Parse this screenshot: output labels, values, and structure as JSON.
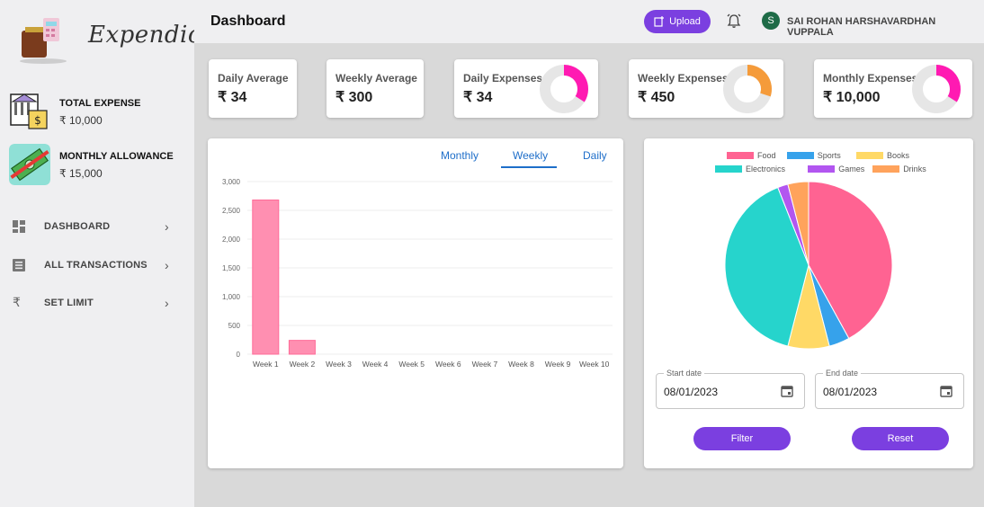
{
  "app": {
    "logo_text": "Expendio"
  },
  "sidebar": {
    "stats": [
      {
        "title": "TOTAL EXPENSE",
        "value": "₹ 10,000",
        "icon": "bank-cash-icon"
      },
      {
        "title": "MONTHLY ALLOWANCE",
        "value": "₹ 15,000",
        "icon": "money-icon"
      }
    ],
    "nav": [
      {
        "label": "DASHBOARD",
        "icon": "dashboard-icon"
      },
      {
        "label": "ALL TRANSACTIONS",
        "icon": "list-icon"
      },
      {
        "label": "SET LIMIT",
        "icon": "rupee-icon"
      }
    ]
  },
  "header": {
    "title": "Dashboard",
    "upload_label": "Upload",
    "avatar_initial": "S",
    "user_name": "SAI ROHAN HARSHAVARDHAN VUPPALA"
  },
  "summary_cards": [
    {
      "title": "Daily Average",
      "value": "₹ 34"
    },
    {
      "title": "Weekly Average",
      "value": "₹ 300"
    },
    {
      "title": "Daily Expenses",
      "value": "₹ 34",
      "fraction": 0.34,
      "color": "#ff1ab2"
    },
    {
      "title": "Weekly Expenses",
      "value": "₹ 450",
      "fraction": 0.3,
      "color": "#f59b3a"
    },
    {
      "title": "Monthly Expenses",
      "value": "₹ 10,000",
      "fraction": 0.34,
      "color": "#ff1ab2"
    }
  ],
  "bar_panel": {
    "tabs": [
      "Monthly",
      "Weekly",
      "Daily"
    ],
    "active_tab": "Weekly"
  },
  "filters": {
    "start_label": "Start date",
    "start_value": "08/01/2023",
    "end_label": "End date",
    "end_value": "08/01/2023",
    "filter_label": "Filter",
    "reset_label": "Reset"
  },
  "colors": {
    "accent": "#7b3fe0",
    "tab_blue": "#1e6ec9",
    "bar": "#ff8fb1"
  },
  "chart_data": [
    {
      "type": "bar",
      "categories": [
        "Week 1",
        "Week 2",
        "Week 3",
        "Week 4",
        "Week 5",
        "Week 6",
        "Week 7",
        "Week 8",
        "Week 9",
        "Week 10"
      ],
      "values": [
        2680,
        240,
        0,
        0,
        0,
        0,
        0,
        0,
        0,
        0
      ],
      "ylim": [
        0,
        3000
      ],
      "yticks": [
        "0",
        "500",
        "1,000",
        "1,500",
        "2,000",
        "2,500",
        "3,000"
      ],
      "grid": true,
      "color": "#ff8fb1"
    },
    {
      "type": "pie",
      "legend_position": "top",
      "series": [
        {
          "name": "Food",
          "value": 42,
          "color": "#ff6392"
        },
        {
          "name": "Sports",
          "value": 4,
          "color": "#36a2eb"
        },
        {
          "name": "Books",
          "value": 8,
          "color": "#ffd966"
        },
        {
          "name": "Electronics",
          "value": 40,
          "color": "#26d4cc"
        },
        {
          "name": "Games",
          "value": 2,
          "color": "#b256f0"
        },
        {
          "name": "Drinks",
          "value": 4,
          "color": "#ffa35c"
        }
      ]
    }
  ]
}
